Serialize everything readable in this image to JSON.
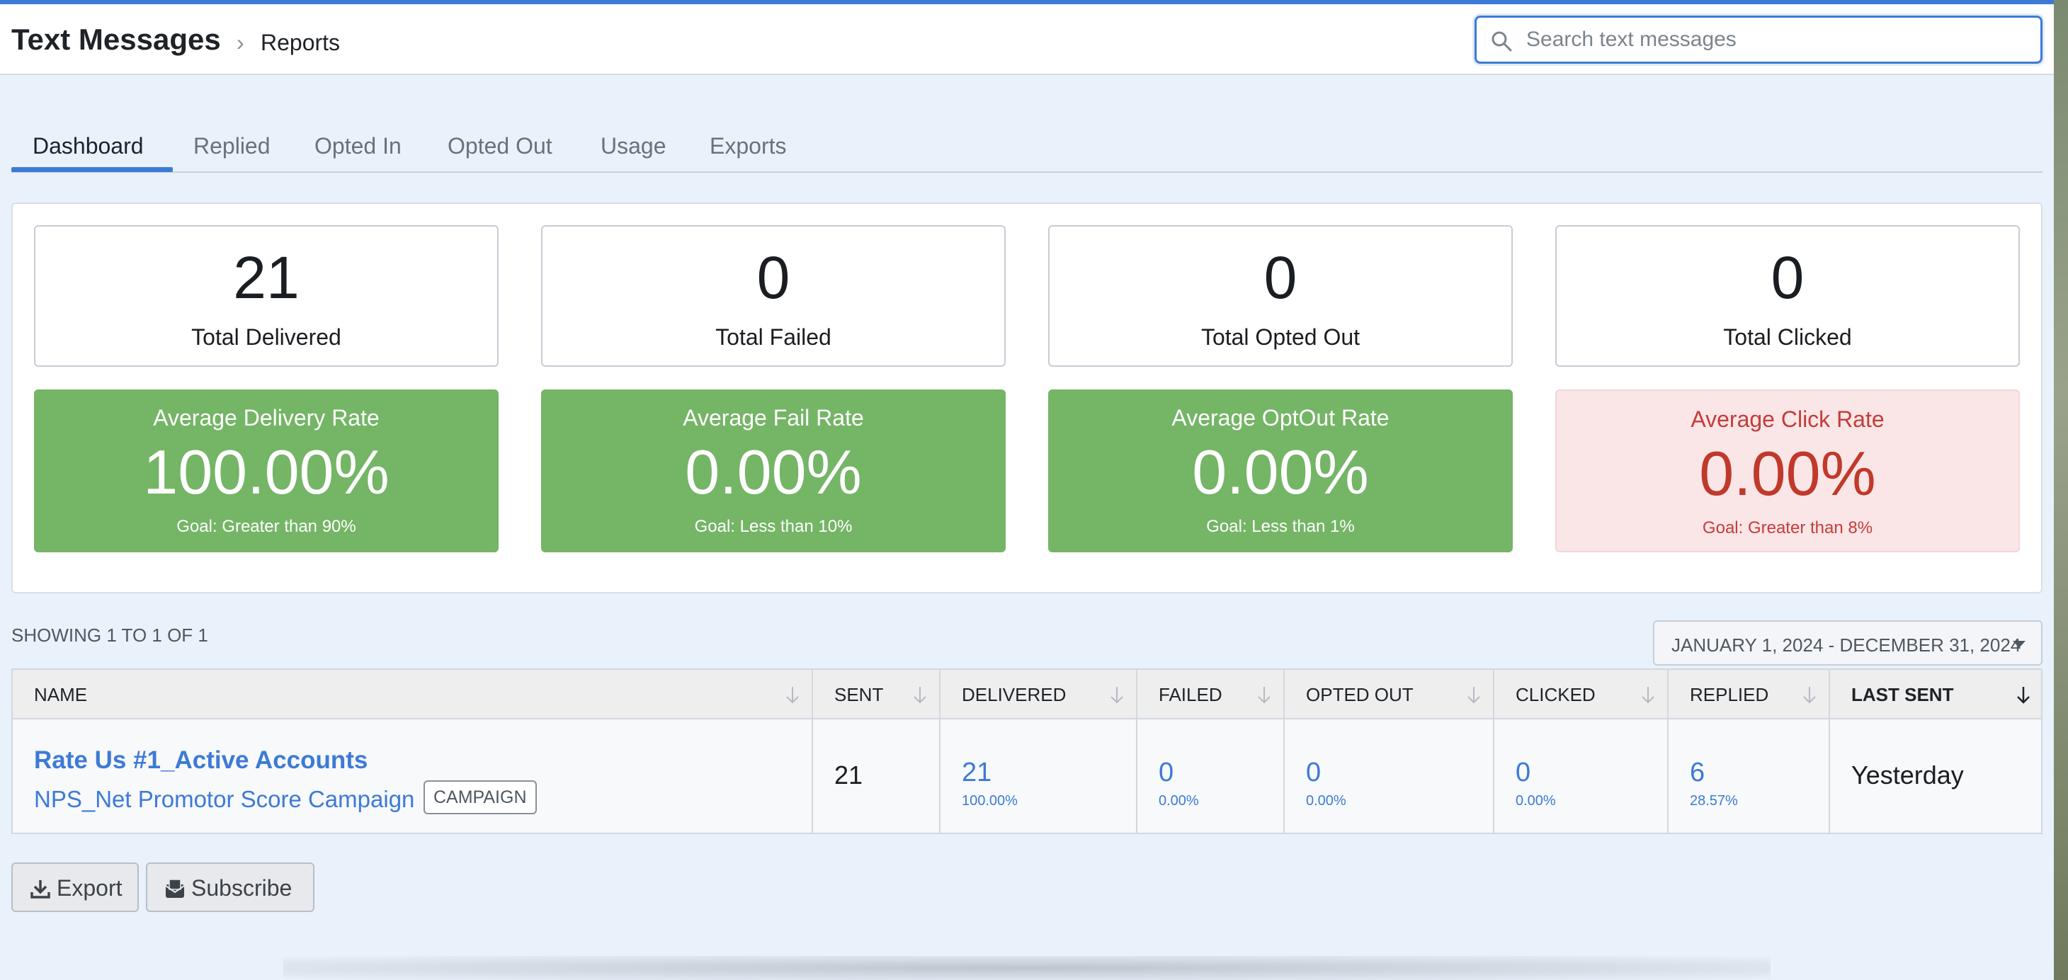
{
  "header": {
    "title": "Text Messages",
    "crumb_sep": "›",
    "crumb": "Reports",
    "search_placeholder": "Search text messages"
  },
  "tabs": [
    {
      "label": "Dashboard",
      "active": true
    },
    {
      "label": "Replied"
    },
    {
      "label": "Opted In"
    },
    {
      "label": "Opted Out"
    },
    {
      "label": "Usage"
    },
    {
      "label": "Exports"
    }
  ],
  "stats": [
    {
      "value": "21",
      "label": "Total Delivered"
    },
    {
      "value": "0",
      "label": "Total Failed"
    },
    {
      "value": "0",
      "label": "Total Opted Out"
    },
    {
      "value": "0",
      "label": "Total Clicked"
    }
  ],
  "rates": [
    {
      "label": "Average Delivery Rate",
      "value": "100.00%",
      "goal": "Goal: Greater than 90%",
      "status": "good"
    },
    {
      "label": "Average Fail Rate",
      "value": "0.00%",
      "goal": "Goal: Less than 10%",
      "status": "good"
    },
    {
      "label": "Average OptOut Rate",
      "value": "0.00%",
      "goal": "Goal: Less than 1%",
      "status": "good"
    },
    {
      "label": "Average Click Rate",
      "value": "0.00%",
      "goal": "Goal: Greater than 8%",
      "status": "bad"
    }
  ],
  "colors": {
    "accent": "#3d7ad6",
    "good": "#74b566",
    "bad_bg": "#fbe6e7",
    "bad_text": "#c0392b"
  },
  "table": {
    "showing": "SHOWING 1 TO 1 OF 1",
    "date_range": "JANUARY 1, 2024 - DECEMBER 31, 2024",
    "columns": [
      "NAME",
      "SENT",
      "DELIVERED",
      "FAILED",
      "OPTED OUT",
      "CLICKED",
      "REPLIED",
      "LAST SENT"
    ],
    "row": {
      "name": "Rate Us #1_Active Accounts",
      "campaign": "NPS_Net Promotor Score Campaign",
      "badge": "CAMPAIGN",
      "sent": "21",
      "delivered": "21",
      "delivered_pct": "100.00%",
      "failed": "0",
      "failed_pct": "0.00%",
      "opted_out": "0",
      "opted_out_pct": "0.00%",
      "clicked": "0",
      "clicked_pct": "0.00%",
      "replied": "6",
      "replied_pct": "28.57%",
      "last_sent": "Yesterday"
    }
  },
  "actions": {
    "export_label": "Export",
    "subscribe_label": "Subscribe"
  },
  "icons": {
    "search": "search-icon",
    "export": "download-icon",
    "subscribe": "envelope-icon",
    "sort": "sort-arrow-icon"
  }
}
